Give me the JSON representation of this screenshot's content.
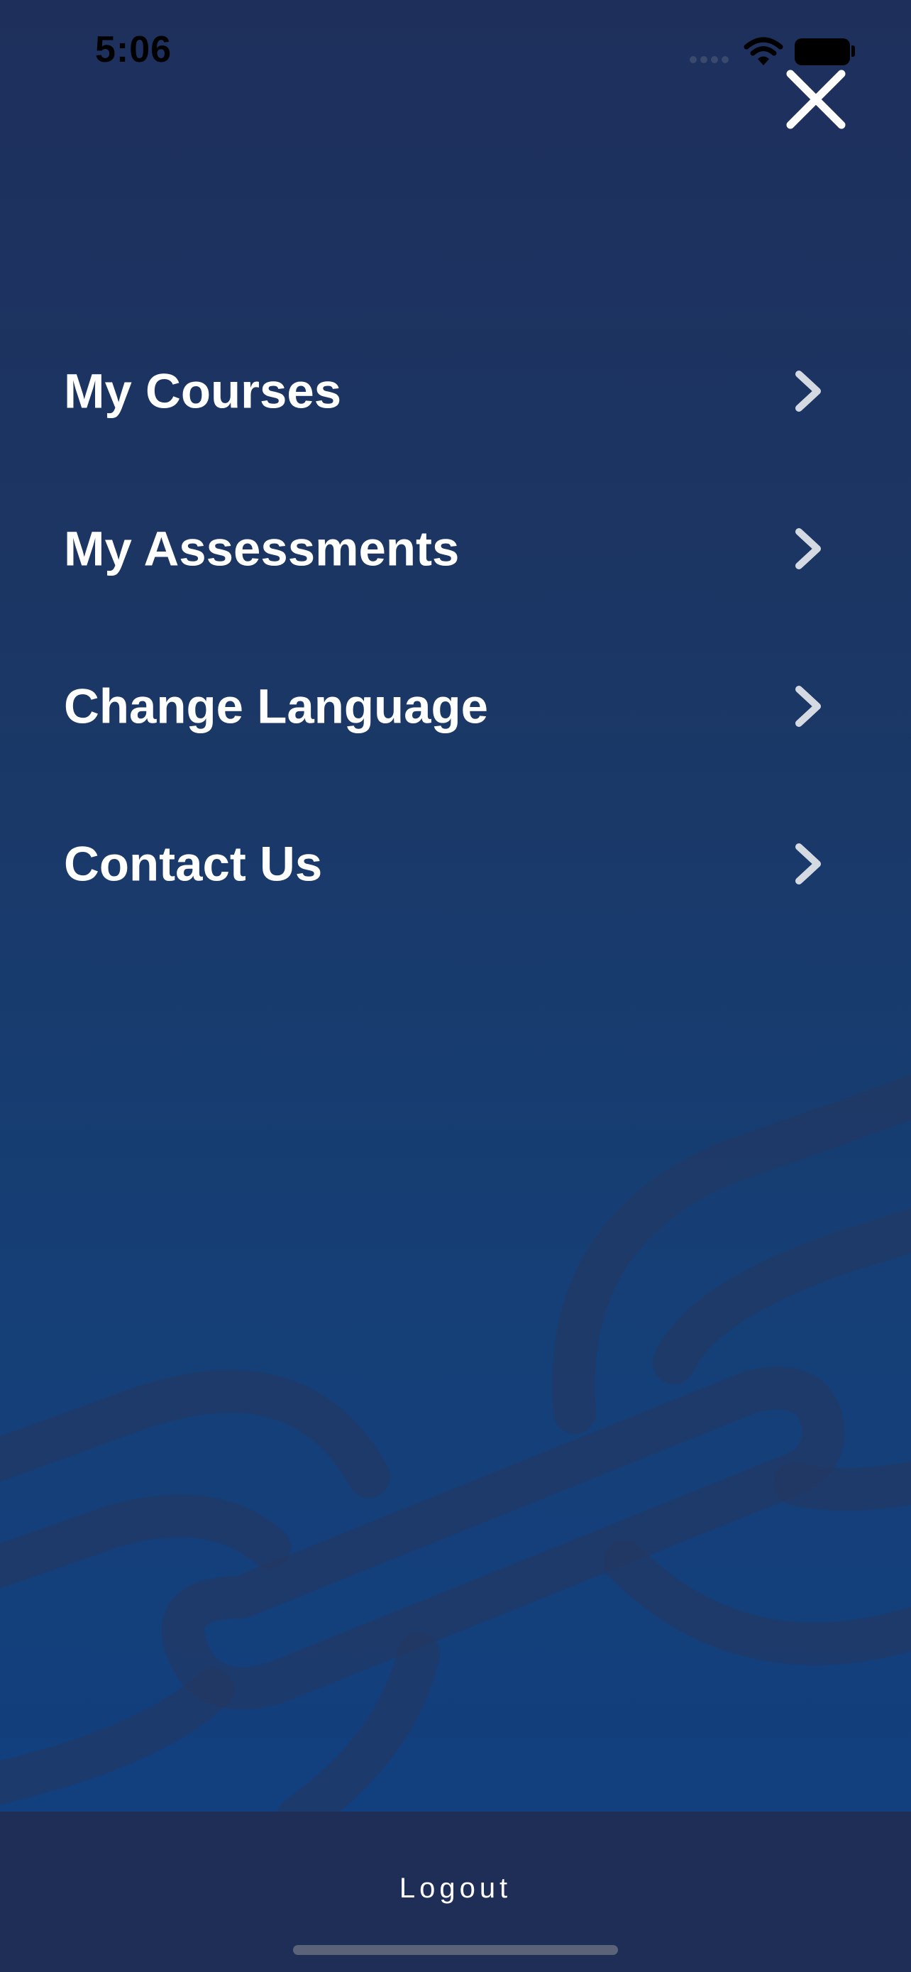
{
  "status_bar": {
    "time": "5:06",
    "signal_icon": "cellular-signal-icon",
    "wifi_icon": "wifi-icon",
    "battery_icon": "battery-icon"
  },
  "close_icon": "close-icon",
  "menu": {
    "items": [
      {
        "label": "My Courses",
        "icon": "chevron-right-icon"
      },
      {
        "label": "My Assessments",
        "icon": "chevron-right-icon"
      },
      {
        "label": "Change Language",
        "icon": "chevron-right-icon"
      },
      {
        "label": "Contact Us",
        "icon": "chevron-right-icon"
      }
    ]
  },
  "footer": {
    "logout_label": "Logout"
  },
  "colors": {
    "background_top": "#1e2f5c",
    "background_bottom": "#113f80",
    "footer": "#1f2e57",
    "text": "#ffffff",
    "chevron": "#d5d9e2"
  }
}
